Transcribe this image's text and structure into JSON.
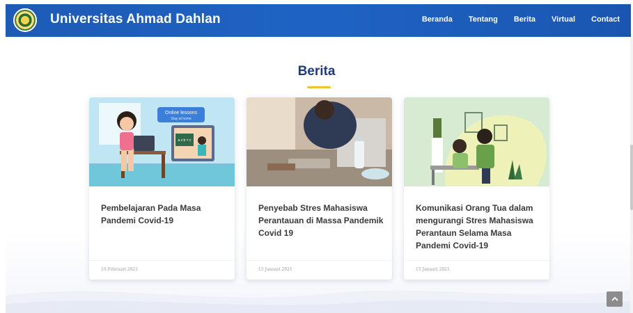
{
  "header": {
    "brand": "Universitas Ahmad Dahlan",
    "logo_icon": "university-seal-logo",
    "nav": [
      "Beranda",
      "Tentang",
      "Berita",
      "Virtual",
      "Contact"
    ]
  },
  "section": {
    "title": "Berita",
    "accent_color": "#f2c230"
  },
  "cards": [
    {
      "image_badge_title": "Online lessons",
      "image_badge_sub": "Stay at home",
      "image_board_text": "a x b = c",
      "title": "Pembelajaran Pada Masa Pandemi Covid-19",
      "date": "19 Februari 2021"
    },
    {
      "title": "Penyebab Stres Mahasiswa Perantauan di Massa Pandemik Covid 19",
      "date": "15 Januari 2021"
    },
    {
      "title": "Komunikasi Orang Tua dalam mengurangi Stres Mahasiswa Perantaun Selama Masa Pandemi Covid-19",
      "date": "15 Januari 2021"
    }
  ],
  "scroll_top_icon": "chevron-up-icon",
  "colors": {
    "navbar": "#1e63c4",
    "title": "#1f3a7a"
  }
}
